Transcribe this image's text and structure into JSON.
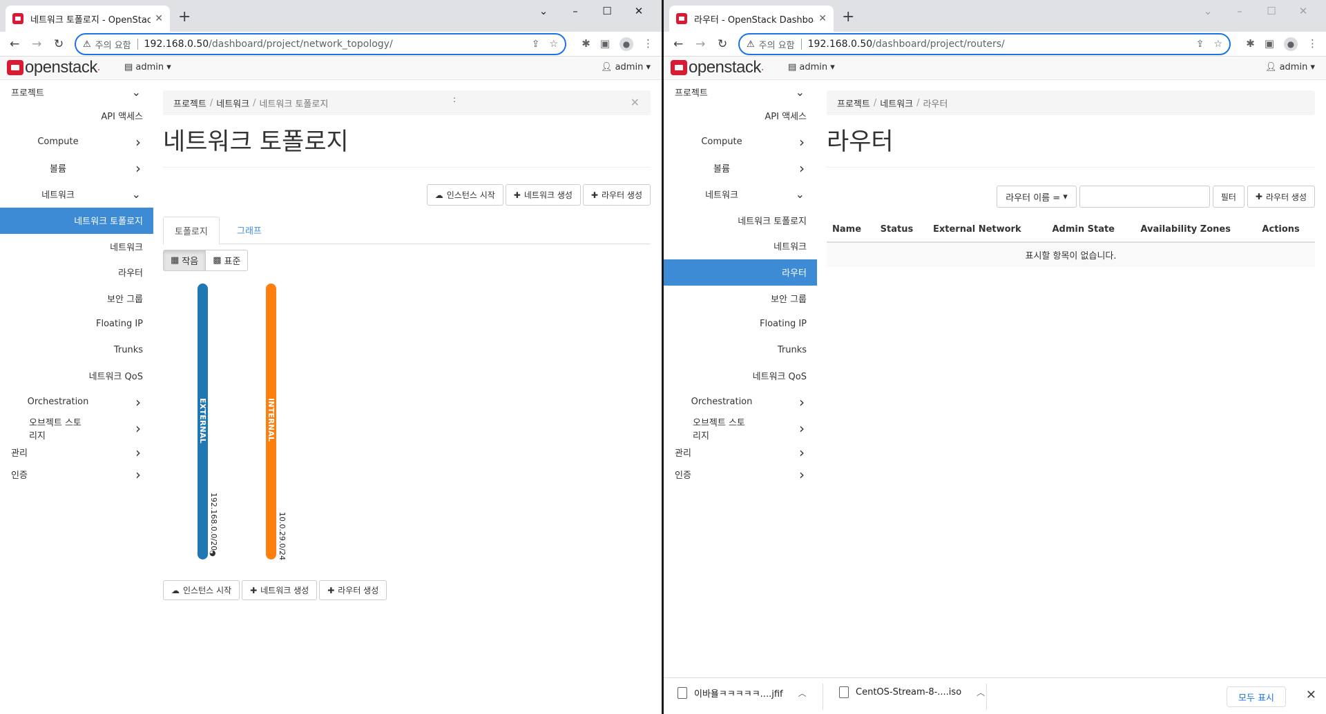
{
  "left": {
    "tab_title": "네트워크 토폴로지 - OpenStack",
    "security": "주의 요함",
    "url_host": "192.168.0.50",
    "url_path": "/dashboard/project/network_topology/",
    "logo": "openstack",
    "project_menu": "admin",
    "user_menu": "admin",
    "sidebar": [
      {
        "label": "프로젝트",
        "level": 1,
        "chev": "down"
      },
      {
        "label": "API 액세스",
        "level": 3
      },
      {
        "label": "Compute",
        "level": 2,
        "chev": "right"
      },
      {
        "label": "볼륨",
        "level": 2,
        "chev": "right"
      },
      {
        "label": "네트워크",
        "level": 2,
        "chev": "down"
      },
      {
        "label": "네트워크 토폴로지",
        "level": 3,
        "active": true
      },
      {
        "label": "네트워크",
        "level": 3
      },
      {
        "label": "라우터",
        "level": 3
      },
      {
        "label": "보안 그룹",
        "level": 3
      },
      {
        "label": "Floating IP",
        "level": 3
      },
      {
        "label": "Trunks",
        "level": 3
      },
      {
        "label": "네트워크 QoS",
        "level": 3
      },
      {
        "label": "Orchestration",
        "level": 2,
        "chev": "right"
      },
      {
        "label": "오브젝트 스토리지",
        "level": 2,
        "chev": "right"
      },
      {
        "label": "관리",
        "level": 1,
        "chev": "right"
      },
      {
        "label": "인증",
        "level": 1,
        "chev": "right"
      }
    ],
    "breadcrumb": [
      "프로젝트",
      "네트워크",
      "네트워크 토폴로지"
    ],
    "page_title": "네트워크 토폴로지",
    "actions": [
      "인스턴스 시작",
      "네트워크 생성",
      "라우터 생성"
    ],
    "tabs": [
      "토폴로지",
      "그래프"
    ],
    "view_toggle": [
      "작음",
      "표준"
    ],
    "networks": [
      {
        "name": "EXTERNAL",
        "cidr": "192.168.0.0/20",
        "color": "#1f77b4"
      },
      {
        "name": "INTERNAL",
        "cidr": "10.0.29.0/24",
        "color": "#ff7f0e"
      }
    ]
  },
  "right": {
    "tab_title": "라우터 - OpenStack Dashboard",
    "security": "주의 요함",
    "url_host": "192.168.0.50",
    "url_path": "/dashboard/project/routers/",
    "logo": "openstack",
    "project_menu": "admin",
    "user_menu": "admin",
    "sidebar": [
      {
        "label": "프로젝트",
        "level": 1,
        "chev": "down"
      },
      {
        "label": "API 액세스",
        "level": 3
      },
      {
        "label": "Compute",
        "level": 2,
        "chev": "right"
      },
      {
        "label": "볼륨",
        "level": 2,
        "chev": "right"
      },
      {
        "label": "네트워크",
        "level": 2,
        "chev": "down"
      },
      {
        "label": "네트워크 토폴로지",
        "level": 3
      },
      {
        "label": "네트워크",
        "level": 3
      },
      {
        "label": "라우터",
        "level": 3,
        "active": true
      },
      {
        "label": "보안 그룹",
        "level": 3
      },
      {
        "label": "Floating IP",
        "level": 3
      },
      {
        "label": "Trunks",
        "level": 3
      },
      {
        "label": "네트워크 QoS",
        "level": 3
      },
      {
        "label": "Orchestration",
        "level": 2,
        "chev": "right"
      },
      {
        "label": "오브젝트 스토리지",
        "level": 2,
        "chev": "right"
      },
      {
        "label": "관리",
        "level": 1,
        "chev": "right"
      },
      {
        "label": "인증",
        "level": 1,
        "chev": "right"
      }
    ],
    "breadcrumb": [
      "프로젝트",
      "네트워크",
      "라우터"
    ],
    "page_title": "라우터",
    "filter_select": "라우터 이름 =",
    "filter_button": "필터",
    "create_button": "라우터 생성",
    "columns": [
      "Name",
      "Status",
      "External Network",
      "Admin State",
      "Availability Zones",
      "Actions"
    ],
    "empty_message": "표시할 항목이 없습니다.",
    "downloads": [
      "이바욜ㅋㅋㅋㅋㅋ....jfif",
      "CentOS-Stream-8-....iso"
    ],
    "show_all": "모두 표시"
  }
}
